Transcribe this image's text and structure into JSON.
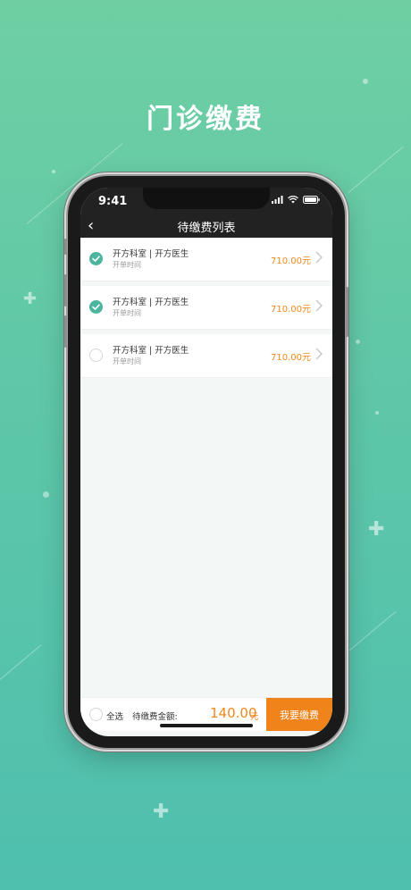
{
  "headline": "门诊缴费",
  "status_bar": {
    "time": "9:41"
  },
  "nav": {
    "back_icon": "‹",
    "title": "待缴费列表"
  },
  "items": [
    {
      "title": "开方科室 | 开方医生",
      "subtitle": "开单时间",
      "amount": "710.00元",
      "checked": true
    },
    {
      "title": "开方科室 | 开方医生",
      "subtitle": "开单时间",
      "amount": "710.00元",
      "checked": true
    },
    {
      "title": "开方科室 | 开方医生",
      "subtitle": "开单时间",
      "amount": "710.00元",
      "checked": false
    }
  ],
  "footer": {
    "select_all": "全选",
    "total_label": "待缴费金额:",
    "total_value": "140.00",
    "total_unit": "元",
    "pay_button": "我要缴费"
  },
  "colors": {
    "accent": "#4bb59e",
    "amount": "#f0881c",
    "pay_button": "#f0831a",
    "nav": "#222222"
  }
}
